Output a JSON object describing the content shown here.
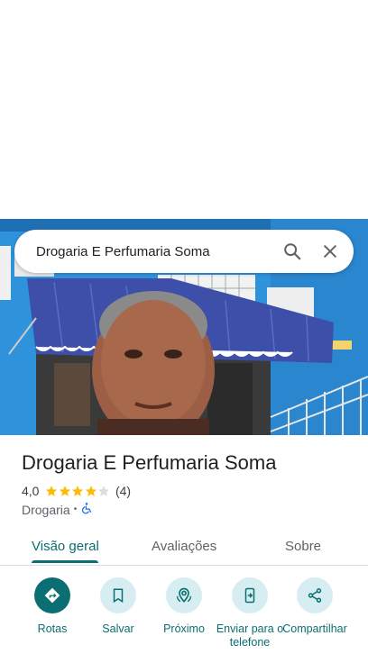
{
  "search": {
    "query": "Drogaria E Perfumaria Soma",
    "search_icon": "search-icon",
    "close_icon": "close-icon"
  },
  "place": {
    "title": "Drogaria E Perfumaria Soma",
    "rating_text": "4,0",
    "rating_value": 4.0,
    "rating_max": 5,
    "review_count": "(4)",
    "category": "Drogaria",
    "separator": "•",
    "accessibility_icon": "wheelchair-icon"
  },
  "tabs": [
    {
      "label": "Visão geral",
      "active": true
    },
    {
      "label": "Avaliações",
      "active": false
    },
    {
      "label": "Sobre",
      "active": false
    }
  ],
  "actions": [
    {
      "label": "Rotas",
      "icon": "directions-icon"
    },
    {
      "label": "Salvar",
      "icon": "bookmark-icon"
    },
    {
      "label": "Próximo",
      "icon": "nearby-icon"
    },
    {
      "label": "Enviar para o telefone",
      "icon": "send-to-phone-icon"
    },
    {
      "label": "Compartilhar",
      "icon": "share-icon"
    }
  ],
  "colors": {
    "accent": "#0b6e73",
    "action_bg": "#d6eef2",
    "star": "#fbbc04"
  }
}
